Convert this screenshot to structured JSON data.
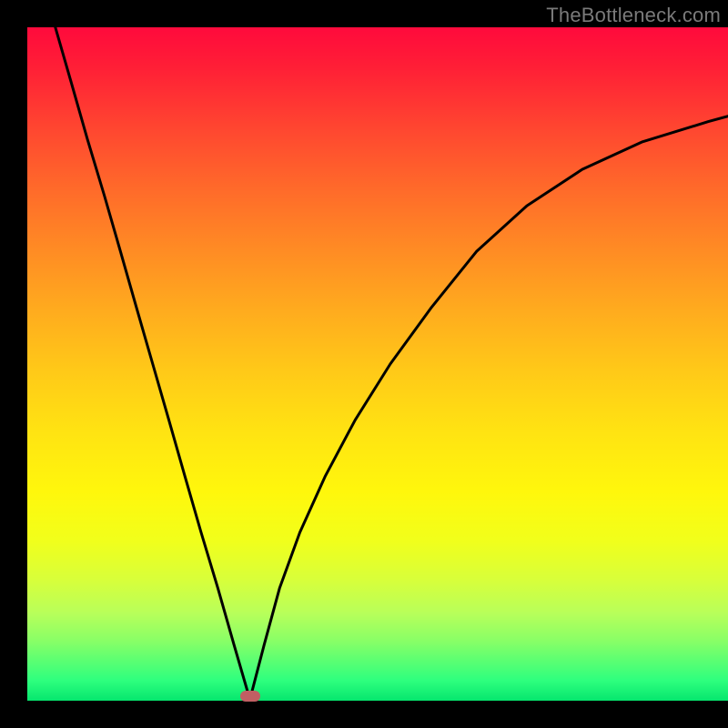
{
  "watermark": "TheBottleneck.com",
  "chart_data": {
    "type": "line",
    "title": "",
    "xlabel": "",
    "ylabel": "",
    "xlim": [
      0,
      100
    ],
    "ylim": [
      0,
      100
    ],
    "series": [
      {
        "name": "left-branch",
        "x": [
          4.0,
          6.3,
          8.6,
          11.0,
          13.3,
          15.6,
          17.9,
          20.2,
          22.5,
          24.8,
          27.2,
          29.5,
          31.4
        ],
        "y": [
          100.0,
          91.7,
          83.3,
          75.0,
          66.7,
          58.3,
          50.0,
          41.7,
          33.3,
          25.0,
          16.7,
          8.3,
          1.5
        ]
      },
      {
        "name": "right-branch",
        "x": [
          32.1,
          33.8,
          36.0,
          38.9,
          42.5,
          46.8,
          51.8,
          57.6,
          64.1,
          71.3,
          79.2,
          87.8,
          97.2,
          100.0
        ],
        "y": [
          1.5,
          8.3,
          16.7,
          25.0,
          33.3,
          41.7,
          50.0,
          58.3,
          66.7,
          73.5,
          78.9,
          83.0,
          86.0,
          86.8
        ]
      }
    ],
    "optimum_marker": {
      "x": 31.8,
      "y": 0.7
    },
    "gradient_stops": [
      {
        "pos": 0,
        "color": "#ff0a3c"
      },
      {
        "pos": 50,
        "color": "#ffc918"
      },
      {
        "pos": 100,
        "color": "#06e66e"
      }
    ]
  }
}
